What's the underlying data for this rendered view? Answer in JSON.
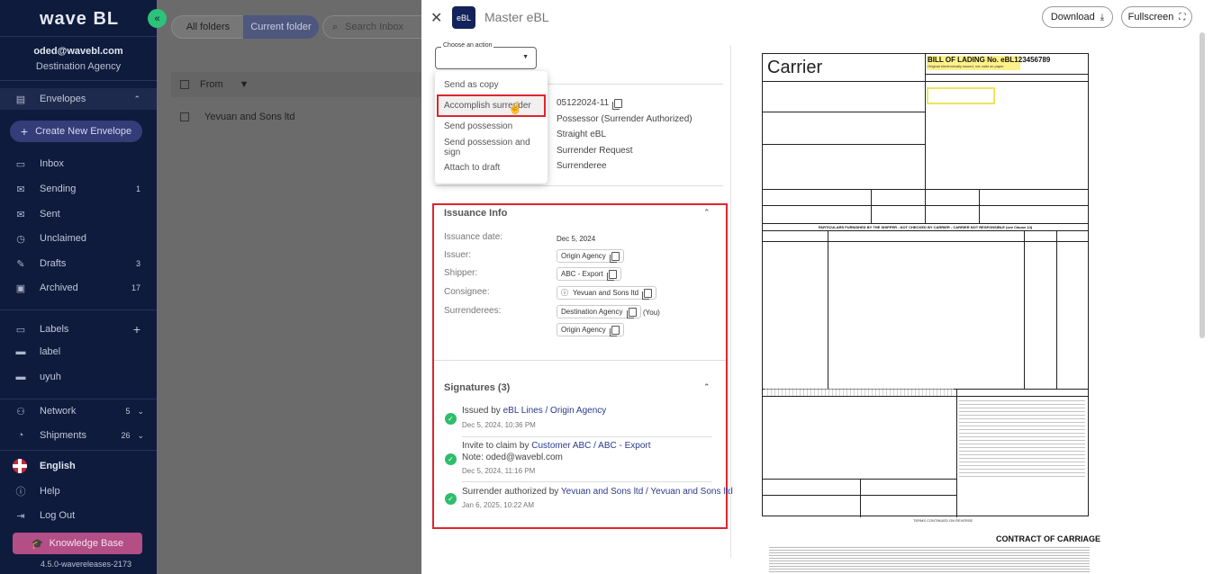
{
  "app": {
    "logo": "wave BL",
    "collapse_icon": "chevron-double-left-icon"
  },
  "user": {
    "email": "oded@wavebl.com",
    "agency": "Destination Agency"
  },
  "sidebar": {
    "envelopes": "Envelopes",
    "create_envelope": "Create New Envelope",
    "items": [
      {
        "label": "Inbox",
        "count": ""
      },
      {
        "label": "Sending",
        "count": "1"
      },
      {
        "label": "Sent",
        "count": ""
      },
      {
        "label": "Unclaimed",
        "count": ""
      },
      {
        "label": "Drafts",
        "count": "3"
      },
      {
        "label": "Archived",
        "count": "17"
      }
    ],
    "labels_title": "Labels",
    "labels": [
      "label",
      "uyuh"
    ],
    "network": {
      "label": "Network",
      "count": "5"
    },
    "shipments": {
      "label": "Shipments",
      "count": "26"
    },
    "language": "English",
    "help": "Help",
    "logout": "Log Out",
    "knowledge_base": "Knowledge Base",
    "version": "4.5.0-wavereleases-2173"
  },
  "list": {
    "tab_all": "All folders",
    "tab_current": "Current folder",
    "search_placeholder": "Search Inbox",
    "col_from": "From",
    "rows": [
      "Yevuan and Sons ltd"
    ]
  },
  "modal": {
    "badge": "eBL",
    "title": "Master eBL",
    "download": "Download",
    "fullscreen": "Fullscreen",
    "action_label": "Choose an action",
    "actions": [
      "Send as copy",
      "Accomplish surrender",
      "Send possession",
      "Send possession and sign",
      "Attach to draft"
    ],
    "details": [
      "05122024-11",
      "Possessor (Surrender Authorized)",
      "Straight eBL",
      "Surrender Request",
      "Surrenderee"
    ],
    "issuance": {
      "title": "Issuance Info",
      "date_label": "Issuance date:",
      "date": "Dec 5, 2024",
      "issuer_label": "Issuer:",
      "issuer": "Origin Agency",
      "shipper_label": "Shipper:",
      "shipper": "ABC - Export",
      "consignee_label": "Consignee:",
      "consignee": "Yevuan and Sons ltd",
      "surrenderees_label": "Surrenderees:",
      "surrenderee_1": "Destination Agency",
      "you": "(You)",
      "surrenderee_2": "Origin Agency"
    },
    "signatures": {
      "title": "Signatures (3)",
      "items": [
        {
          "prefix": "Issued by ",
          "party": "eBL Lines / Origin Agency",
          "note": "",
          "date": "Dec 5, 2024, 10:36 PM"
        },
        {
          "prefix": "Invite to claim by ",
          "party": "Customer ABC / ABC - Export",
          "note": "Note: oded@wavebl.com",
          "date": "Dec 5, 2024, 11:16 PM"
        },
        {
          "prefix": "Surrender authorized by ",
          "party": "Yevuan and Sons ltd / Yevuan and Sons ltd",
          "note": "",
          "date": "Jan 6, 2025, 10:22 AM"
        }
      ]
    }
  },
  "document": {
    "carrier": "Carrier",
    "bol_title": "BILL OF LADING No. eBL123456789",
    "bol_sub": "Original electronically issued, not valid on paper",
    "band": "PARTICULARS FURNISHED BY THE SHIPPER - NOT CHECKED BY CARRIER - CARRIER NOT RESPONSIBLE (see Clause 14)",
    "contract": "CONTRACT OF CARRIAGE",
    "footer": "TERMS CONTINUED ON REVERSE"
  }
}
